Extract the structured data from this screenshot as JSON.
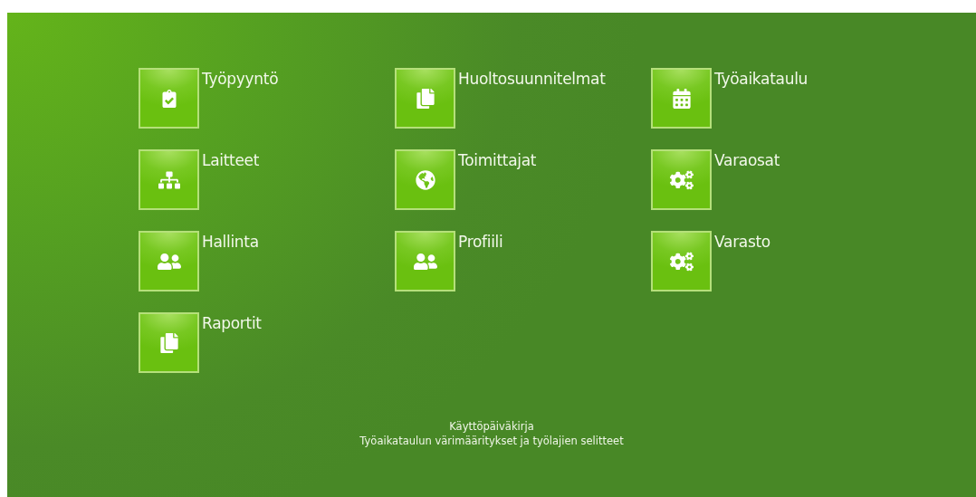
{
  "tiles": [
    {
      "label": "Työpyyntö",
      "kind": "clipboard"
    },
    {
      "label": "Huoltosuunnitelmat",
      "kind": "documents"
    },
    {
      "label": "Työaikataulu",
      "kind": "calendar"
    },
    {
      "label": "Laitteet",
      "kind": "hierarchy"
    },
    {
      "label": "Toimittajat",
      "kind": "globe"
    },
    {
      "label": "Varaosat",
      "kind": "gears"
    },
    {
      "label": "Hallinta",
      "kind": "users"
    },
    {
      "label": "Profiili",
      "kind": "users"
    },
    {
      "label": "Varasto",
      "kind": "gears"
    },
    {
      "label": "Raportit",
      "kind": "documents"
    }
  ],
  "footer_links": [
    "Käyttöpäiväkirja",
    "Työaikataulun värimääritykset ja työlajien selitteet"
  ]
}
